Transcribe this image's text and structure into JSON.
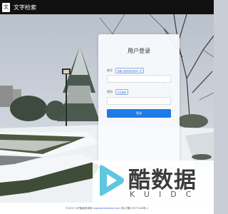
{
  "header": {
    "logo_glyph": "文",
    "title": "文字检索"
  },
  "login": {
    "title": "用户登录",
    "username_label": "账号",
    "username_hint": "请输入账号或手机号一栏",
    "username_placeholder": "",
    "password_label": "密码",
    "password_hint": "忘记密码",
    "password_placeholder": "",
    "submit_label": "登录",
    "accent_color": "#1f7ae8"
  },
  "footer": {
    "copyright": "©2017 ICP备案查询网",
    "link": "www.beianbeian.com",
    "icp": "苏ICP备17077148号-1"
  },
  "watermark": {
    "brand": "酷数据",
    "sub": "KUIDC",
    "icon": "play-logo-icon"
  }
}
